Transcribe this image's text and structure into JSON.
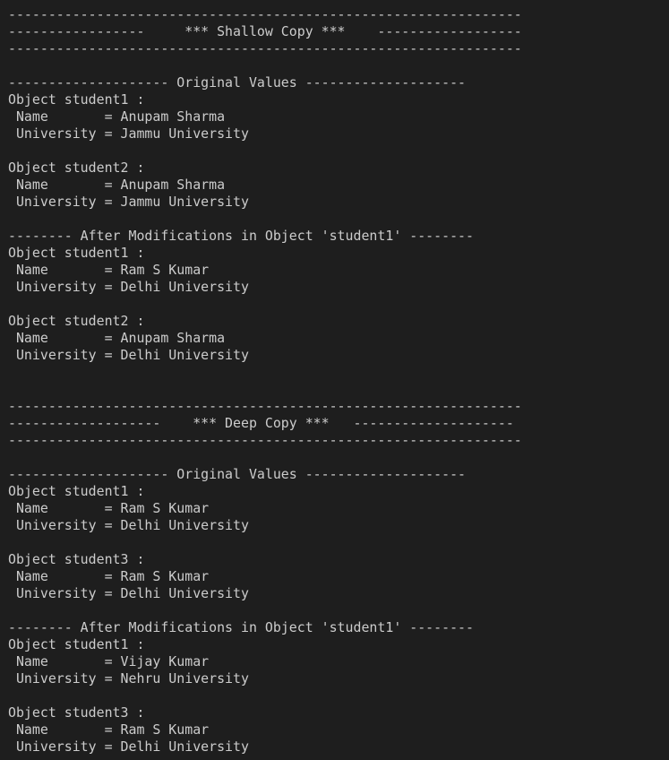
{
  "terminal": {
    "lines": [
      "----------------------------------------------------------------",
      "-----------------     *** Shallow Copy ***    ------------------",
      "----------------------------------------------------------------",
      "",
      "-------------------- Original Values --------------------",
      "Object student1 :",
      " Name       = Anupam Sharma",
      " University = Jammu University",
      "",
      "Object student2 :",
      " Name       = Anupam Sharma",
      " University = Jammu University",
      "",
      "-------- After Modifications in Object 'student1' --------",
      "Object student1 :",
      " Name       = Ram S Kumar",
      " University = Delhi University",
      "",
      "Object student2 :",
      " Name       = Anupam Sharma",
      " University = Delhi University",
      "",
      "",
      "----------------------------------------------------------------",
      "-------------------    *** Deep Copy ***   --------------------",
      "----------------------------------------------------------------",
      "",
      "-------------------- Original Values --------------------",
      "Object student1 :",
      " Name       = Ram S Kumar",
      " University = Delhi University",
      "",
      "Object student3 :",
      " Name       = Ram S Kumar",
      " University = Delhi University",
      "",
      "-------- After Modifications in Object 'student1' --------",
      "Object student1 :",
      " Name       = Vijay Kumar",
      " University = Nehru University",
      "",
      "Object student3 :",
      " Name       = Ram S Kumar",
      " University = Delhi University"
    ]
  },
  "colors": {
    "background": "#1e1e1e",
    "foreground": "#cccccc",
    "prompt_green": "#23d18b",
    "prompt_blue": "#3b8eea"
  }
}
